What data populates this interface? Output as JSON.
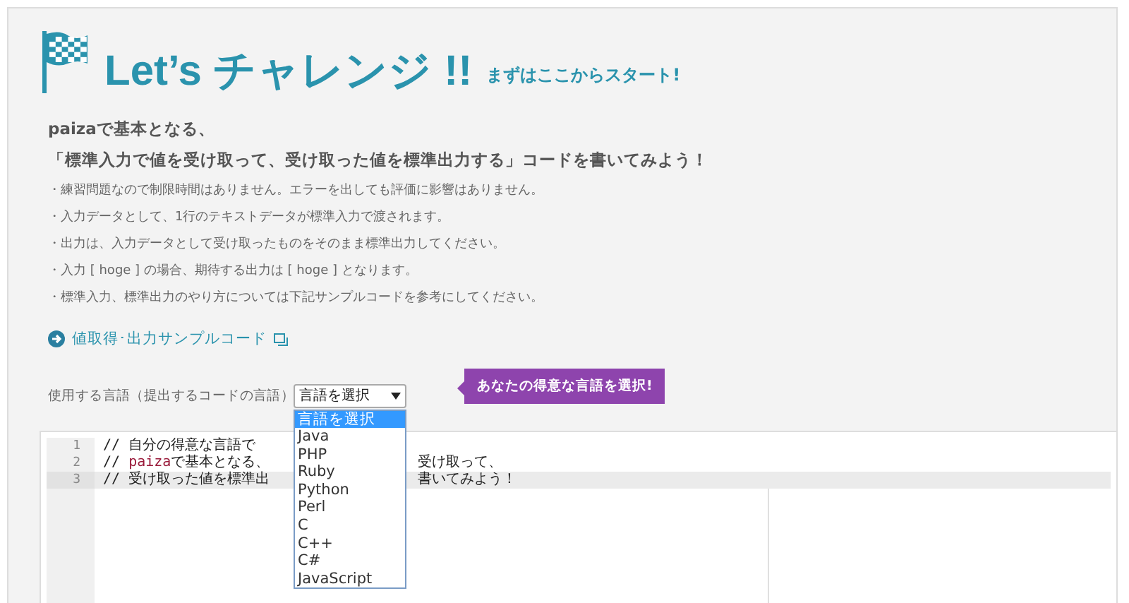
{
  "header": {
    "title": "Let’s チャレンジ !!",
    "subtitle": "まずはここからスタート!"
  },
  "intro": {
    "lead": [
      "paizaで基本となる、",
      "「標準入力で値を受け取って、受け取った値を標準出力する」コードを書いてみよう！"
    ],
    "notes": [
      "・練習問題なので制限時間はありません。エラーを出しても評価に影響はありません。",
      "・入力データとして、1行のテキストデータが標準入力で渡されます。",
      "・出力は、入力データとして受け取ったものをそのまま標準出力してください。",
      "・入力 [ hoge ] の場合、期待する出力は [ hoge ] となります。",
      "・標準入力、標準出力のやり方については下記サンプルコードを参考にしてください。"
    ]
  },
  "sample_link": {
    "label": "値取得･出力サンプルコード"
  },
  "language": {
    "label": "使用する言語（提出するコードの言語）",
    "select_value": "言語を選択",
    "tooltip": "あなたの得意な言語を選択!",
    "options": [
      {
        "label": "言語を選択",
        "selected": true
      },
      {
        "label": "Java",
        "selected": false
      },
      {
        "label": "PHP",
        "selected": false
      },
      {
        "label": "Ruby",
        "selected": false
      },
      {
        "label": "Python",
        "selected": false
      },
      {
        "label": "Perl",
        "selected": false
      },
      {
        "label": "C",
        "selected": false
      },
      {
        "label": "C++",
        "selected": false
      },
      {
        "label": "C#",
        "selected": false
      },
      {
        "label": "JavaScript",
        "selected": false
      }
    ]
  },
  "editor": {
    "lines": [
      {
        "number": "1",
        "current": false,
        "left": [
          {
            "kind": "comment",
            "text": "// 自分の得意な言語で"
          }
        ]
      },
      {
        "number": "2",
        "current": false,
        "left": [
          {
            "kind": "comment",
            "text": "// "
          },
          {
            "kind": "keyword",
            "text": "paiza"
          },
          {
            "kind": "comment",
            "text": "で基本となる、"
          }
        ],
        "right": "受け取って、"
      },
      {
        "number": "3",
        "current": true,
        "left": [
          {
            "kind": "comment",
            "text": "// 受け取った値を標準出"
          }
        ],
        "right": "書いてみよう！"
      }
    ]
  }
}
